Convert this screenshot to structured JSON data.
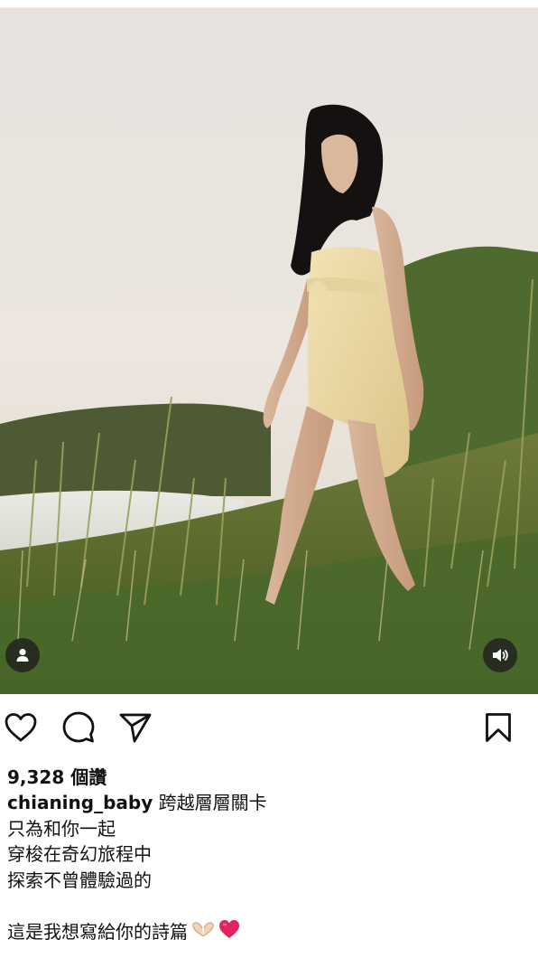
{
  "post": {
    "likes_text": "9,328 個讚",
    "username": "chianing_baby",
    "caption_first_line": "跨越層層關卡",
    "caption_lines": [
      "只為和你一起",
      "穿梭在奇幻旅程中",
      "探索不曾體驗過的"
    ],
    "caption_last_line": "這是我想寫給你的詩篇",
    "emojis": [
      "heart-hands-emoji",
      "red-heart-emoji"
    ]
  },
  "icons": {
    "like": "heart-outline-icon",
    "comment": "comment-bubble-icon",
    "share": "paper-plane-icon",
    "save": "bookmark-icon",
    "user_tag": "user-tag-icon",
    "sound": "speaker-icon"
  },
  "colors": {
    "text": "#111111",
    "icon": "#111111",
    "media_button_bg": "#1e1e1e",
    "heart_red": "#e0245e"
  }
}
